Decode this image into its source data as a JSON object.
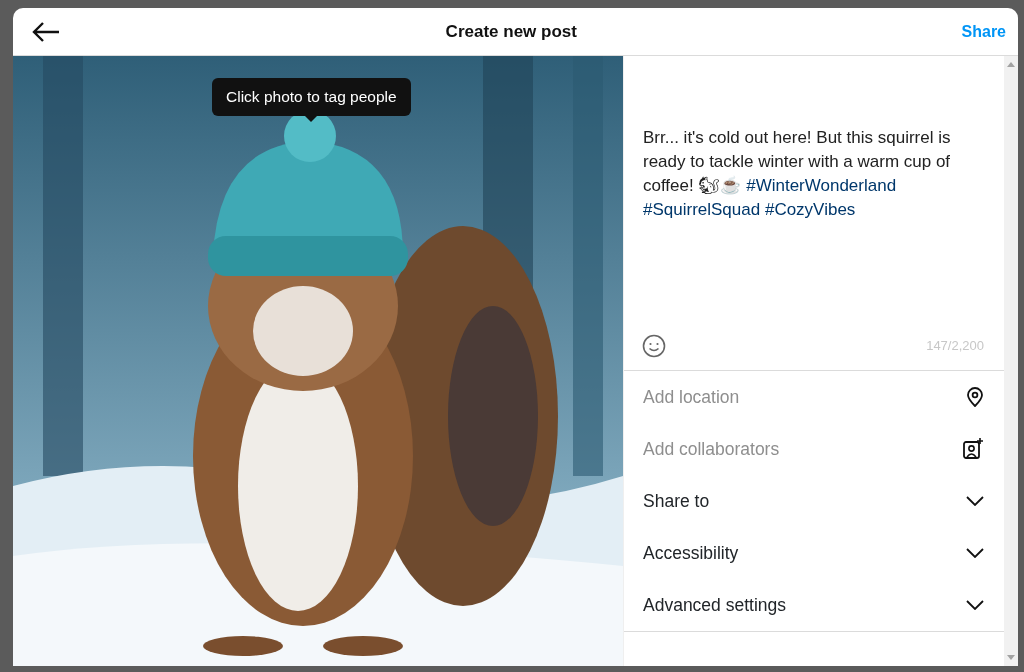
{
  "header": {
    "title": "Create new post",
    "share_label": "Share"
  },
  "photo": {
    "kind": "picture",
    "tooltip": "Click photo to tag people"
  },
  "caption": {
    "text": "Brr... it's cold out here! But this squirrel is ready to tackle winter with a warm cup of coffee! 🐿☕",
    "hashtags": [
      "#WinterWonderland",
      "#SquirrelSquad",
      "#CozyVibes"
    ],
    "counter": "147/2,200"
  },
  "options": [
    {
      "kind": "location",
      "label": "Add location"
    },
    {
      "kind": "collaborators",
      "label": "Add collaborators"
    },
    {
      "kind": "expander",
      "label": "Share to",
      "expanded": false
    },
    {
      "kind": "expander",
      "label": "Accessibility",
      "expanded": false
    },
    {
      "kind": "expander",
      "label": "Advanced settings",
      "expanded": false
    }
  ]
}
